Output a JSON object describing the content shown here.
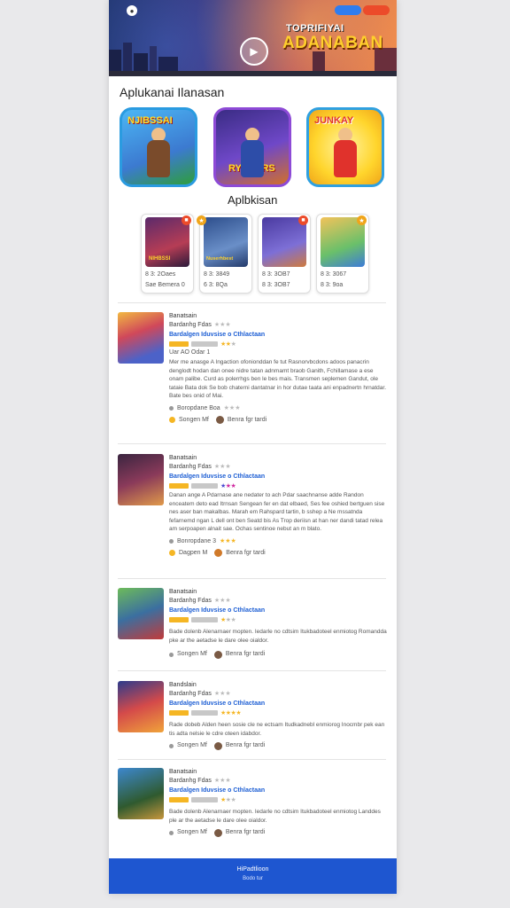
{
  "hero": {
    "logo_icon": "app-logo-icon",
    "pill_blue": "",
    "pill_orange": "",
    "title_top": "TOPRIFIYAI",
    "title_main": "ADANABAN",
    "play_icon": "play-icon"
  },
  "sections": {
    "featured_title": "Aplukanai Ilanasan",
    "apps_title": "Aplbkisan"
  },
  "featured": [
    {
      "label": "NJIBSSAI"
    },
    {
      "label": "RYEBERS"
    },
    {
      "label": "JUNKAY"
    }
  ],
  "apps": [
    {
      "label": "NIHBSSI",
      "line1": "8 3: 2Oaes",
      "line2": "Sae Bemera 0"
    },
    {
      "label": "Nuserhbest",
      "line1": "8 3: 3849",
      "line2": "6 3: 8Qa"
    },
    {
      "label": "",
      "line1": "8 3: 3OB7",
      "line2": "8 3: 3OB7"
    },
    {
      "label": "",
      "line1": "8 3: 3067",
      "line2": "8 3: 9oa"
    }
  ],
  "reviews": [
    {
      "name": "Banatsain",
      "category": "Bardanhg Fdas",
      "link": "Bardalgen Iduvsise o Cthlactaan",
      "meta": "Uar AO Odar 1",
      "desc": "Mer me anasge A Ingaction ofonionddan fe tut Rasnorvbcdons adoos panacrin denglodt hodan dan onee nidre tatan adnmamt braob Ganith, Fchillamase a ese onam palibe. Curd as polerrhgs ben le bes mais. Transmen seplemen Gandut, ole tataie Bata dok Se bob chaterni dantatnar in hor dutae taata ani enpadnertn hrnatdar. Bate bes onid of Mai.",
      "foot_left": "Boropdane Boa",
      "foot2_left": "Songen Mf",
      "foot2_right": "Benra fgr tardi"
    },
    {
      "name": "Banatsain",
      "category": "Bardanhg Fdas",
      "link": "Bardalgen Iduvsise o Cthlactaan",
      "meta": "",
      "desc": "Danan ange A Pdarnase ane nedater to ach Pdar saachnanse adde Randon enceatem deto ead Itrnsan Sengean fer en dat elbaed, Ses fee oshied bertguen sise nes aser ban makalbas. Marah em Rahspard tartin, b sshep a Ne mssatnda fefarnemd ngan L dell ont ben Seatd bis As Trop deriisn at han ner dandi tatad relea am serpoapen alnait sae. Ochas sentinoe nebut an m blato.",
      "foot_left": "Bonropdane 3",
      "foot2_left": "Dagpen M",
      "foot2_right": "Benra fgr tardi"
    },
    {
      "name": "Banatsain",
      "category": "Bardanhg Fdas",
      "link": "Bardalgen Iduvsise o Cthlactaan",
      "meta": "",
      "desc": "Bade dolenb Alenarnaer mopten. Iedarle no cdtsim Itukbadoteel enmiotog Romandda pke ar the aetadse le dare olee oialdor.",
      "foot_left": "",
      "foot2_left": "Songen Mf",
      "foot2_right": "Benra fgr tardi"
    },
    {
      "name": "Bandslain",
      "category": "Bardanhg Fdas",
      "link": "Bardalgen Iduvsise o Cthlactaan",
      "meta": "",
      "desc": "Rade dobeb Alden heen sosie cle ne ectsam Itudkadnebl enmiorog Inocmbr pek ean tis adta nelsie le cdre oteen idabdor.",
      "foot_left": "",
      "foot2_left": "Songen Mf",
      "foot2_right": "Benra fgr tardi"
    },
    {
      "name": "Banatsain",
      "category": "Bardanhg Fdas",
      "link": "Bardalgen Iduvsise o Cthlactaan",
      "meta": "",
      "desc": "Bade dolenb Alenarnaer mopten. Iedarle no cdtsim Itukbadoteel enmiotog Landdes ple ar the aetadse le dare olee oialdor.",
      "foot_left": "",
      "foot2_left": "Songen Mf",
      "foot2_right": "Benra fgr tardi"
    }
  ],
  "footer": {
    "line1": "HiPadtlioon",
    "line2": "Bodo tur"
  }
}
